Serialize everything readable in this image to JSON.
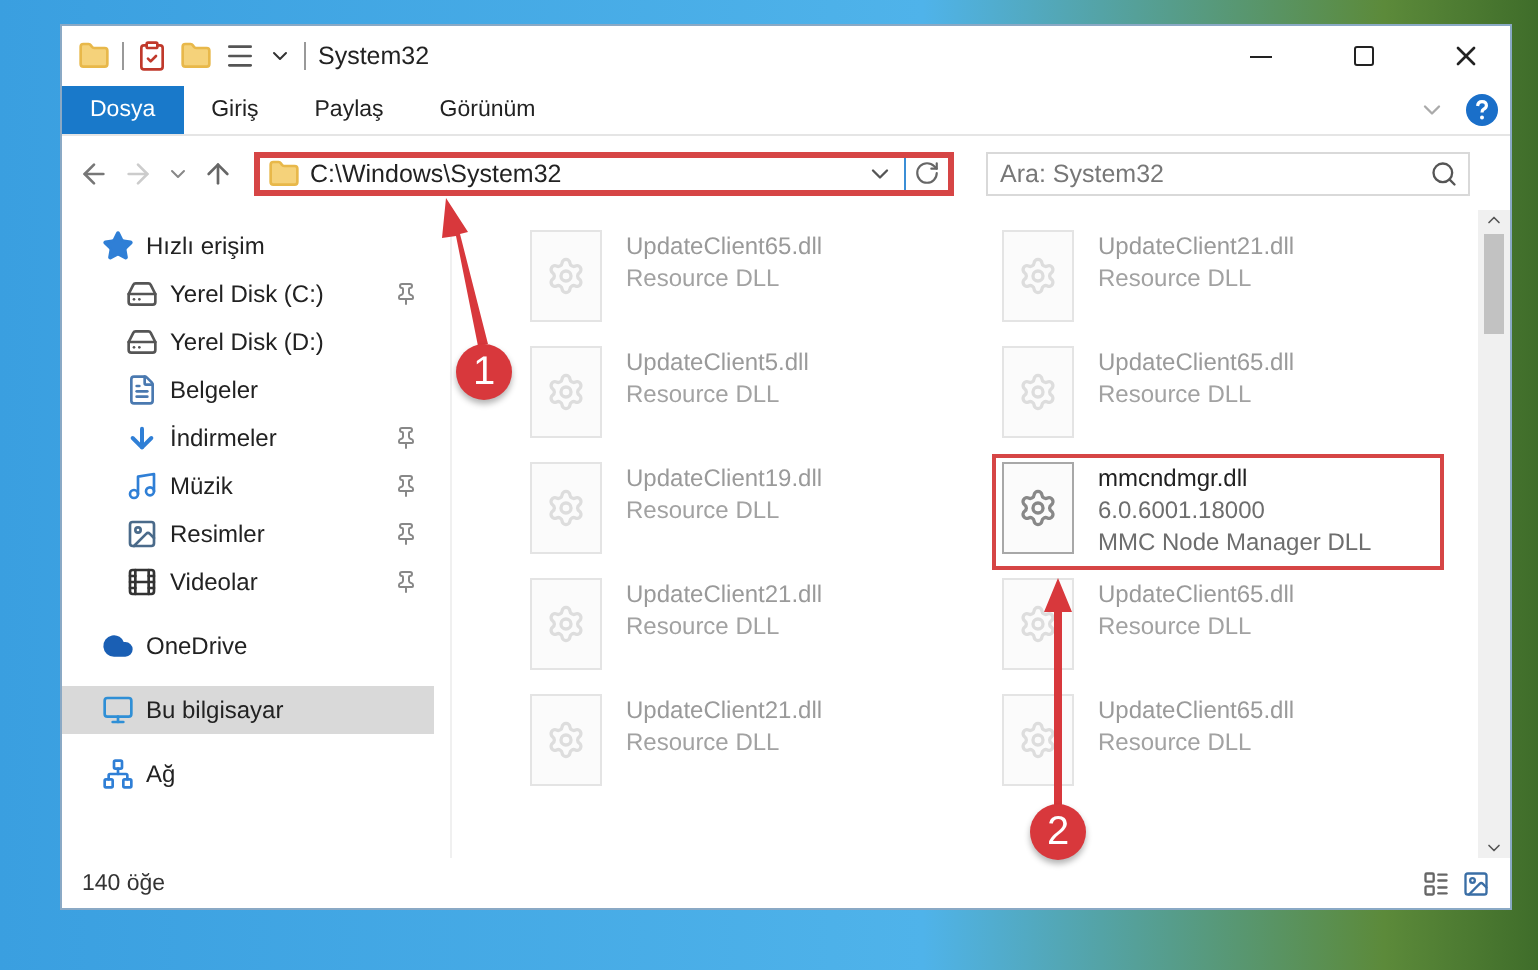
{
  "window": {
    "title": "System32"
  },
  "ribbon": {
    "tabs": [
      {
        "label": "Dosya",
        "selected": true
      },
      {
        "label": "Giriş",
        "selected": false
      },
      {
        "label": "Paylaş",
        "selected": false
      },
      {
        "label": "Görünüm",
        "selected": false
      }
    ]
  },
  "address_bar": {
    "path": "C:\\Windows\\System32",
    "marked": true
  },
  "search": {
    "placeholder": "Ara: System32"
  },
  "sidebar": {
    "items": [
      {
        "label": "Hızlı erişim",
        "kind": "quick",
        "selected": false,
        "children": [
          {
            "label": "Yerel Disk (C:)",
            "kind": "disk",
            "pinned": true,
            "selected": false
          },
          {
            "label": "Yerel Disk (D:)",
            "kind": "disk",
            "pinned": false,
            "selected": false
          },
          {
            "label": "Belgeler",
            "kind": "docs",
            "pinned": false,
            "selected": false
          },
          {
            "label": "İndirmeler",
            "kind": "downloads",
            "pinned": true,
            "selected": false
          },
          {
            "label": "Müzik",
            "kind": "music",
            "pinned": true,
            "selected": false
          },
          {
            "label": "Resimler",
            "kind": "pictures",
            "pinned": true,
            "selected": false
          },
          {
            "label": "Videolar",
            "kind": "videos",
            "pinned": true,
            "selected": false
          }
        ]
      },
      {
        "label": "OneDrive",
        "kind": "cloud",
        "selected": false
      },
      {
        "label": "Bu bilgisayar",
        "kind": "pc",
        "selected": true
      },
      {
        "label": "Ağ",
        "kind": "network",
        "selected": false
      }
    ]
  },
  "files": [
    {
      "name": "UpdateClient65.dll",
      "lines": [
        "Resource DLL"
      ],
      "marked": false
    },
    {
      "name": "UpdateClient21.dll",
      "lines": [
        "Resource DLL"
      ],
      "marked": false
    },
    {
      "name": "UpdateClient5.dll",
      "lines": [
        "Resource DLL"
      ],
      "marked": false
    },
    {
      "name": "UpdateClient65.dll",
      "lines": [
        "Resource DLL"
      ],
      "marked": false
    },
    {
      "name": "UpdateClient19.dll",
      "lines": [
        "Resource DLL"
      ],
      "marked": false
    },
    {
      "name": "mmcndmgr.dll",
      "lines": [
        "6.0.6001.18000",
        "MMC Node Manager DLL"
      ],
      "marked": true
    },
    {
      "name": "UpdateClient21.dll",
      "lines": [
        "Resource DLL"
      ],
      "marked": false
    },
    {
      "name": "UpdateClient65.dll",
      "lines": [
        "Resource DLL"
      ],
      "marked": false
    },
    {
      "name": "UpdateClient21.dll",
      "lines": [
        "Resource DLL"
      ],
      "marked": false
    },
    {
      "name": "UpdateClient65.dll",
      "lines": [
        "Resource DLL"
      ],
      "marked": false
    }
  ],
  "status_bar": {
    "count": "140 öğe"
  },
  "annotations": [
    {
      "number": "1"
    },
    {
      "number": "2"
    }
  ]
}
